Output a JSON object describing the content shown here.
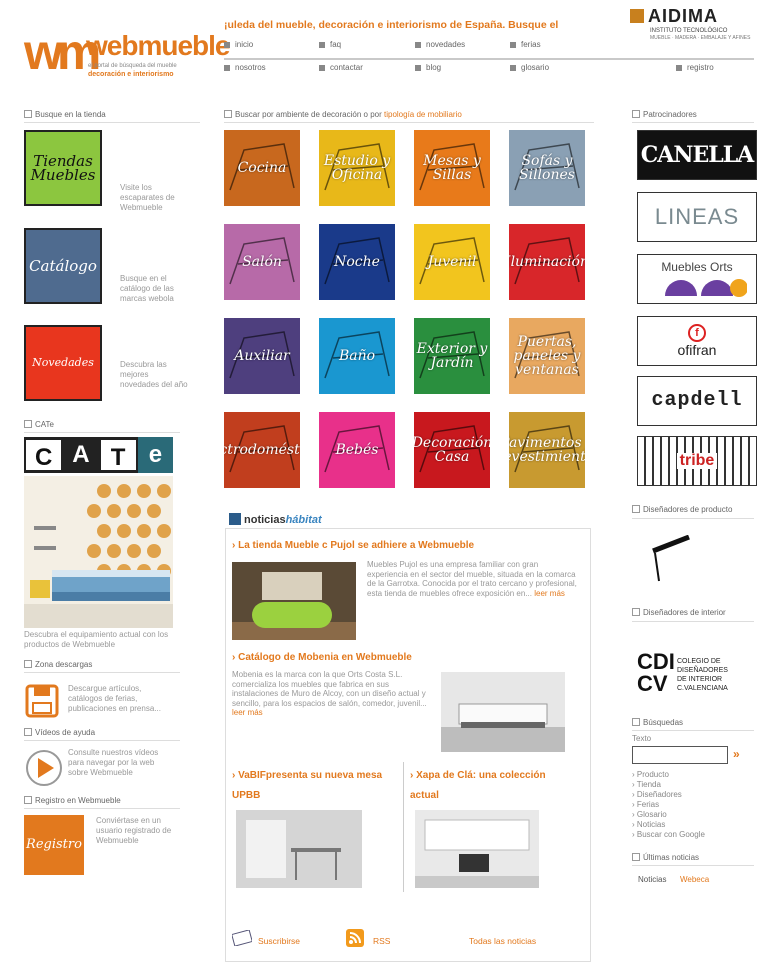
{
  "header": {
    "logo_mark": "wm",
    "logo_name": "webmueble",
    "logo_tag1": "el portal de búsqueda del mueble",
    "logo_tag2": "decoración e interiorismo",
    "headline": "¡uleda del mueble, decoración e interiorismo de España. Busque el",
    "nav_row1": [
      "inicio",
      "faq",
      "novedades",
      "ferias"
    ],
    "nav_row2": [
      "nosotros",
      "contactar",
      "blog",
      "glosario",
      "registro"
    ],
    "aidima_name": "AIDIMA",
    "aidima_sub1": "INSTITUTO TECNOLÓGICO",
    "aidima_sub2": "MUEBLE · MADERA · EMBALAJE Y AFINES"
  },
  "left": {
    "heading1": "Busque en la tienda",
    "tiendas": {
      "thumb": "Tiendas Muebles",
      "text": "Visite los escaparates de Webmueble"
    },
    "catalogo": {
      "thumb": "Catálogo",
      "text": "Busque en el catálogo de las marcas webola"
    },
    "novedades": {
      "thumb": "Novedades",
      "text": "Descubra las mejores novedades del año"
    },
    "cate_heading": "CATe",
    "cate_letters": [
      "C",
      "A",
      "T",
      "e"
    ],
    "cate_caption": "Descubra el equipamiento actual con los productos de Webmueble",
    "descargas_heading": "Zona descargas",
    "descargas_text": "Descargue artículos, catálogos de ferias, publicaciones en prensa...",
    "videos_heading": "Vídeos de ayuda",
    "videos_text": "Consulte nuestros vídeos para navegar por la web sobre Webmueble",
    "registro_heading": "Registro en Webmueble",
    "registro_thumb": "Registro",
    "registro_text": "Conviértase en un usuario registrado de Webmueble"
  },
  "center": {
    "heading_pre": "Buscar por ambiente de decoración o por",
    "heading_link": "tipología de mobiliario",
    "tiles": [
      {
        "label": "Cocina",
        "color": "#c8681e"
      },
      {
        "label": "Estudio y Oficina",
        "color": "#e8b819"
      },
      {
        "label": "Mesas y Sillas",
        "color": "#e87a1a"
      },
      {
        "label": "Sofás y Sillones",
        "color": "#8aa0b4"
      },
      {
        "label": "Salón",
        "color": "#b76aa8"
      },
      {
        "label": "Noche",
        "color": "#1a3a8a"
      },
      {
        "label": "Juvenil",
        "color": "#f2c51e"
      },
      {
        "label": "Iluminación",
        "color": "#d8262a"
      },
      {
        "label": "Auxiliar",
        "color": "#4e3f7e"
      },
      {
        "label": "Baño",
        "color": "#1a97d0"
      },
      {
        "label": "Exterior y Jardín",
        "color": "#2a8f3e"
      },
      {
        "label": "Puertas, paneles y ventanas",
        "color": "#e8a860"
      },
      {
        "label": "Electrodomésticos",
        "color": "#c13e1e"
      },
      {
        "label": "Bebés",
        "color": "#e8308a"
      },
      {
        "label": "Decoración Casa",
        "color": "#c8181e"
      },
      {
        "label": "Pavimentos y Revestimientos",
        "color": "#c89a30"
      }
    ],
    "news_brand_a": "noticias",
    "news_brand_b": "hábitat",
    "news": [
      {
        "title": "La tienda Mueble c Pujol se adhiere a Webmueble",
        "text": "Muebles Pujol es una empresa familiar con gran experiencia en el sector del mueble, situada en la comarca de la Garrotxa. Conocida por el trato cercano y profesional, esta tienda de muebles ofrece exposición en...",
        "more": "leer más"
      },
      {
        "title": "Catálogo de Mobenia en Webmueble",
        "text": "Mobenia es la marca con la que Orts Costa S.L. comercializa los muebles que fabrica en sus instalaciones de Muro de Alcoy, con un diseño actual y sencillo, para los espacios de salón, comedor, juvenil...",
        "more": "leer más"
      },
      {
        "title": "VaBIFpresenta su nueva mesa UPBB",
        "text": ""
      },
      {
        "title": "Xapa de Clá: una colección actual",
        "text": ""
      }
    ],
    "footer": {
      "subscribe": "Suscribirse",
      "rss": "RSS",
      "all": "Todas las noticias"
    }
  },
  "right": {
    "heading1": "Patrocinadores",
    "brands": [
      "CANELLA",
      "LINEAS",
      "Muebles Orts",
      "ofifran",
      "capdell",
      "tribe"
    ],
    "heading2": "Diseñadores de producto",
    "heading3": "Diseñadores de interior",
    "cdicv_a": "CDI",
    "cdicv_b": "CV",
    "cdicv_text": [
      "COLEGIO DE",
      "DISEÑADORES",
      "DE INTERIOR",
      "C.VALENCIANA"
    ],
    "search_heading": "Búsquedas",
    "search_label": "Texto",
    "search_go": "»",
    "search_options": [
      "Producto",
      "Tienda",
      "Diseñadores",
      "Ferias",
      "Glosario",
      "Noticias",
      "Buscar con Google"
    ],
    "latest_heading": "Últimas noticias",
    "latest_label": "Noticias",
    "latest_link": "Webeca"
  }
}
